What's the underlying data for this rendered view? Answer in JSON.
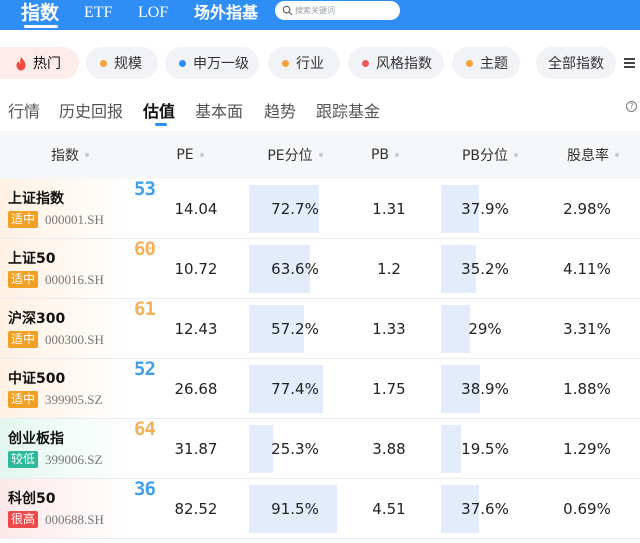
{
  "header": {
    "tabs": [
      "指数",
      "ETF",
      "LOF",
      "场外指基"
    ],
    "search_placeholder": "搜索关键词"
  },
  "categories": {
    "hot": "热门",
    "items": [
      {
        "label": "规模",
        "dot": "#f2a33a"
      },
      {
        "label": "申万一级",
        "dot": "#2f8ef5"
      },
      {
        "label": "行业",
        "dot": "#f2a33a"
      },
      {
        "label": "风格指数",
        "dot": "#e85a5a"
      },
      {
        "label": "主题",
        "dot": "#f2a33a"
      }
    ],
    "all": "全部指数"
  },
  "subtabs": [
    "行情",
    "历史回报",
    "估值",
    "基本面",
    "趋势",
    "跟踪基金"
  ],
  "active_subtab": "估值",
  "table": {
    "columns": [
      "指数",
      "PE",
      "PE分位",
      "PB",
      "PB分位",
      "股息率"
    ],
    "rows": [
      {
        "name": "上证指数",
        "badge": "适中",
        "code": "000001.SH",
        "score": "53",
        "pe": "14.04",
        "pe_pct": "72.7%",
        "pe_pct_val": 72.7,
        "pb": "1.31",
        "pb_pct": "37.9%",
        "pb_pct_val": 37.9,
        "div": "2.98%"
      },
      {
        "name": "上证50",
        "badge": "适中",
        "code": "000016.SH",
        "score": "60",
        "pe": "10.72",
        "pe_pct": "63.6%",
        "pe_pct_val": 63.6,
        "pb": "1.2",
        "pb_pct": "35.2%",
        "pb_pct_val": 35.2,
        "div": "4.11%"
      },
      {
        "name": "沪深300",
        "badge": "适中",
        "code": "000300.SH",
        "score": "61",
        "pe": "12.43",
        "pe_pct": "57.2%",
        "pe_pct_val": 57.2,
        "pb": "1.33",
        "pb_pct": "29%",
        "pb_pct_val": 29,
        "div": "3.31%"
      },
      {
        "name": "中证500",
        "badge": "适中",
        "code": "399905.SZ",
        "score": "52",
        "pe": "26.68",
        "pe_pct": "77.4%",
        "pe_pct_val": 77.4,
        "pb": "1.75",
        "pb_pct": "38.9%",
        "pb_pct_val": 38.9,
        "div": "1.88%"
      },
      {
        "name": "创业板指",
        "badge": "较低",
        "code": "399006.SZ",
        "score": "64",
        "pe": "31.87",
        "pe_pct": "25.3%",
        "pe_pct_val": 25.3,
        "pb": "3.88",
        "pb_pct": "19.5%",
        "pb_pct_val": 19.5,
        "div": "1.29%"
      },
      {
        "name": "科创50",
        "badge": "很高",
        "code": "000688.SH",
        "score": "36",
        "pe": "82.52",
        "pe_pct": "91.5%",
        "pe_pct_val": 91.5,
        "pb": "4.51",
        "pb_pct": "37.6%",
        "pb_pct_val": 37.6,
        "div": "0.69%"
      }
    ]
  },
  "colors": {
    "brand": "#2f8ef5",
    "badge_medium": "#f2a024",
    "badge_low": "#2cb99a",
    "badge_high": "#ee4a4a",
    "score_blue": "#3fa0ea",
    "score_orange": "#f3b15c",
    "bar_fill": "#e2ecfb"
  }
}
